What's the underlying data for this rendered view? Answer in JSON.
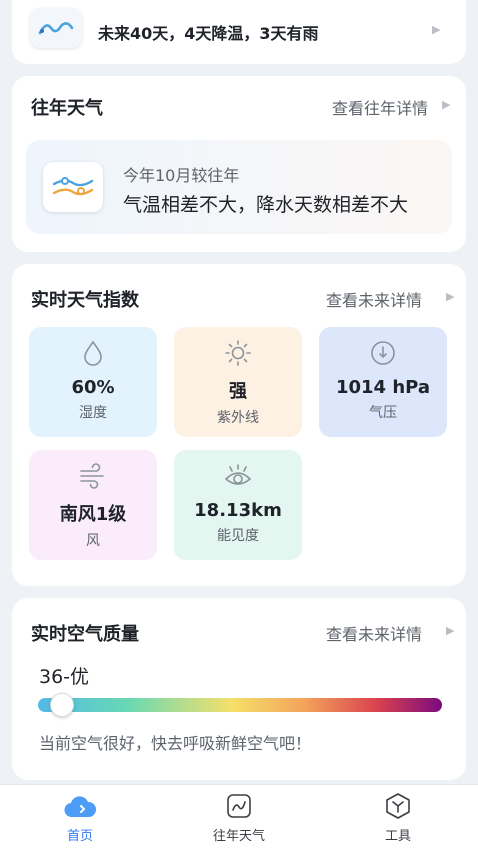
{
  "forecast": {
    "text": "未来40天，4天降温，3天有雨",
    "icon": "trend-wave-icon"
  },
  "history": {
    "title": "往年天气",
    "link": "查看往年详情",
    "subtitle": "今年10月较往年",
    "summary": "气温相差不大，降水天数相差不大",
    "icon": "comparison-chart-icon"
  },
  "index": {
    "title": "实时天气指数",
    "link": "查看未来详情",
    "tiles": [
      {
        "value": "60%",
        "label": "湿度",
        "icon": "droplet-icon",
        "bg": "#e3f3fd"
      },
      {
        "value": "强",
        "label": "紫外线",
        "icon": "sun-icon",
        "bg": "#fdf1e4"
      },
      {
        "value": "1014 hPa",
        "label": "气压",
        "icon": "gauge-icon",
        "bg": "#dde7fb"
      },
      {
        "value": "南风1级",
        "label": "风",
        "icon": "wind-icon",
        "bg": "#fbecfb"
      },
      {
        "value": "18.13km",
        "label": "能见度",
        "icon": "eye-icon",
        "bg": "#e4f6f0"
      }
    ]
  },
  "air": {
    "title": "实时空气质量",
    "link": "查看未来详情",
    "value": "36-优",
    "aqi_fraction": 0.06,
    "tip": "当前空气很好，快去呼吸新鲜空气吧！"
  },
  "nav": [
    {
      "label": "首页",
      "icon": "cloud-home-icon",
      "active": true
    },
    {
      "label": "往年天气",
      "icon": "history-chart-icon",
      "active": false
    },
    {
      "label": "工具",
      "icon": "tools-hexagon-icon",
      "active": false
    }
  ],
  "colors": {
    "accent": "#2f7bf6",
    "page_bg": "#eef1f6"
  }
}
